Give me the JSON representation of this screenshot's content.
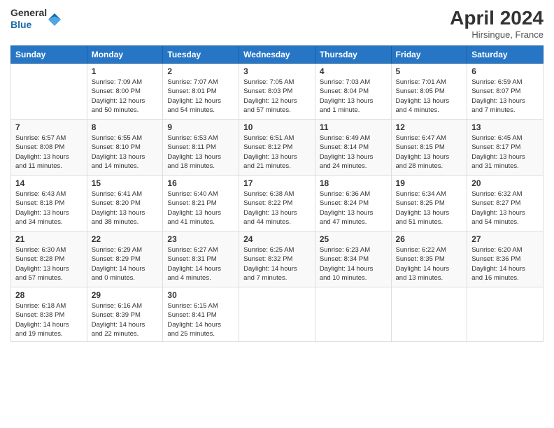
{
  "header": {
    "logo": {
      "general": "General",
      "blue": "Blue"
    },
    "title": "April 2024",
    "location": "Hirsingue, France"
  },
  "weekdays": [
    "Sunday",
    "Monday",
    "Tuesday",
    "Wednesday",
    "Thursday",
    "Friday",
    "Saturday"
  ],
  "weeks": [
    [
      {
        "day": "",
        "info": ""
      },
      {
        "day": "1",
        "info": "Sunrise: 7:09 AM\nSunset: 8:00 PM\nDaylight: 12 hours\nand 50 minutes."
      },
      {
        "day": "2",
        "info": "Sunrise: 7:07 AM\nSunset: 8:01 PM\nDaylight: 12 hours\nand 54 minutes."
      },
      {
        "day": "3",
        "info": "Sunrise: 7:05 AM\nSunset: 8:03 PM\nDaylight: 12 hours\nand 57 minutes."
      },
      {
        "day": "4",
        "info": "Sunrise: 7:03 AM\nSunset: 8:04 PM\nDaylight: 13 hours\nand 1 minute."
      },
      {
        "day": "5",
        "info": "Sunrise: 7:01 AM\nSunset: 8:05 PM\nDaylight: 13 hours\nand 4 minutes."
      },
      {
        "day": "6",
        "info": "Sunrise: 6:59 AM\nSunset: 8:07 PM\nDaylight: 13 hours\nand 7 minutes."
      }
    ],
    [
      {
        "day": "7",
        "info": "Sunrise: 6:57 AM\nSunset: 8:08 PM\nDaylight: 13 hours\nand 11 minutes."
      },
      {
        "day": "8",
        "info": "Sunrise: 6:55 AM\nSunset: 8:10 PM\nDaylight: 13 hours\nand 14 minutes."
      },
      {
        "day": "9",
        "info": "Sunrise: 6:53 AM\nSunset: 8:11 PM\nDaylight: 13 hours\nand 18 minutes."
      },
      {
        "day": "10",
        "info": "Sunrise: 6:51 AM\nSunset: 8:12 PM\nDaylight: 13 hours\nand 21 minutes."
      },
      {
        "day": "11",
        "info": "Sunrise: 6:49 AM\nSunset: 8:14 PM\nDaylight: 13 hours\nand 24 minutes."
      },
      {
        "day": "12",
        "info": "Sunrise: 6:47 AM\nSunset: 8:15 PM\nDaylight: 13 hours\nand 28 minutes."
      },
      {
        "day": "13",
        "info": "Sunrise: 6:45 AM\nSunset: 8:17 PM\nDaylight: 13 hours\nand 31 minutes."
      }
    ],
    [
      {
        "day": "14",
        "info": "Sunrise: 6:43 AM\nSunset: 8:18 PM\nDaylight: 13 hours\nand 34 minutes."
      },
      {
        "day": "15",
        "info": "Sunrise: 6:41 AM\nSunset: 8:20 PM\nDaylight: 13 hours\nand 38 minutes."
      },
      {
        "day": "16",
        "info": "Sunrise: 6:40 AM\nSunset: 8:21 PM\nDaylight: 13 hours\nand 41 minutes."
      },
      {
        "day": "17",
        "info": "Sunrise: 6:38 AM\nSunset: 8:22 PM\nDaylight: 13 hours\nand 44 minutes."
      },
      {
        "day": "18",
        "info": "Sunrise: 6:36 AM\nSunset: 8:24 PM\nDaylight: 13 hours\nand 47 minutes."
      },
      {
        "day": "19",
        "info": "Sunrise: 6:34 AM\nSunset: 8:25 PM\nDaylight: 13 hours\nand 51 minutes."
      },
      {
        "day": "20",
        "info": "Sunrise: 6:32 AM\nSunset: 8:27 PM\nDaylight: 13 hours\nand 54 minutes."
      }
    ],
    [
      {
        "day": "21",
        "info": "Sunrise: 6:30 AM\nSunset: 8:28 PM\nDaylight: 13 hours\nand 57 minutes."
      },
      {
        "day": "22",
        "info": "Sunrise: 6:29 AM\nSunset: 8:29 PM\nDaylight: 14 hours\nand 0 minutes."
      },
      {
        "day": "23",
        "info": "Sunrise: 6:27 AM\nSunset: 8:31 PM\nDaylight: 14 hours\nand 4 minutes."
      },
      {
        "day": "24",
        "info": "Sunrise: 6:25 AM\nSunset: 8:32 PM\nDaylight: 14 hours\nand 7 minutes."
      },
      {
        "day": "25",
        "info": "Sunrise: 6:23 AM\nSunset: 8:34 PM\nDaylight: 14 hours\nand 10 minutes."
      },
      {
        "day": "26",
        "info": "Sunrise: 6:22 AM\nSunset: 8:35 PM\nDaylight: 14 hours\nand 13 minutes."
      },
      {
        "day": "27",
        "info": "Sunrise: 6:20 AM\nSunset: 8:36 PM\nDaylight: 14 hours\nand 16 minutes."
      }
    ],
    [
      {
        "day": "28",
        "info": "Sunrise: 6:18 AM\nSunset: 8:38 PM\nDaylight: 14 hours\nand 19 minutes."
      },
      {
        "day": "29",
        "info": "Sunrise: 6:16 AM\nSunset: 8:39 PM\nDaylight: 14 hours\nand 22 minutes."
      },
      {
        "day": "30",
        "info": "Sunrise: 6:15 AM\nSunset: 8:41 PM\nDaylight: 14 hours\nand 25 minutes."
      },
      {
        "day": "",
        "info": ""
      },
      {
        "day": "",
        "info": ""
      },
      {
        "day": "",
        "info": ""
      },
      {
        "day": "",
        "info": ""
      }
    ]
  ]
}
